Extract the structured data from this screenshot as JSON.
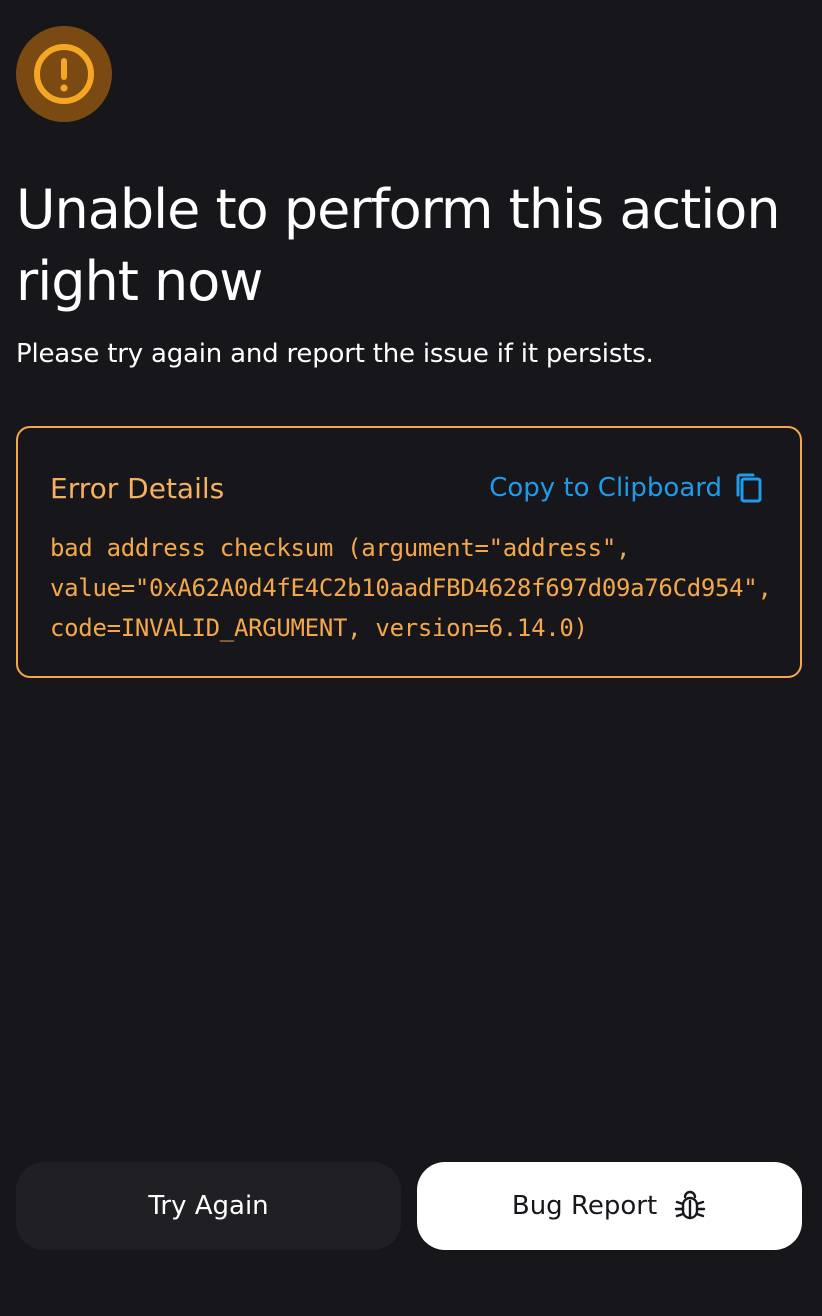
{
  "header": {
    "title": "Unable to perform this action right now",
    "subtitle": "Please try again and report the issue if it persists."
  },
  "error_card": {
    "title": "Error Details",
    "copy_label": "Copy to Clipboard",
    "message": "bad address checksum (argument=\"address\",\nvalue=\"0xA62A0d4fE4C2b10aadFBD4628f697d09a76Cd954\",\ncode=INVALID_ARGUMENT, version=6.14.0)"
  },
  "actions": {
    "try_again_label": "Try Again",
    "bug_report_label": "Bug Report"
  },
  "icons": {
    "warning": "warning-circle-icon",
    "copy": "copy-icon",
    "bug": "bug-icon"
  },
  "colors": {
    "background": "#16161b",
    "warning": "#f5a623",
    "warning_bg": "#7a4a12",
    "error_text": "#f5a84a",
    "link": "#1e9bea",
    "secondary_button": "#1f1f24",
    "primary_button": "#ffffff"
  }
}
